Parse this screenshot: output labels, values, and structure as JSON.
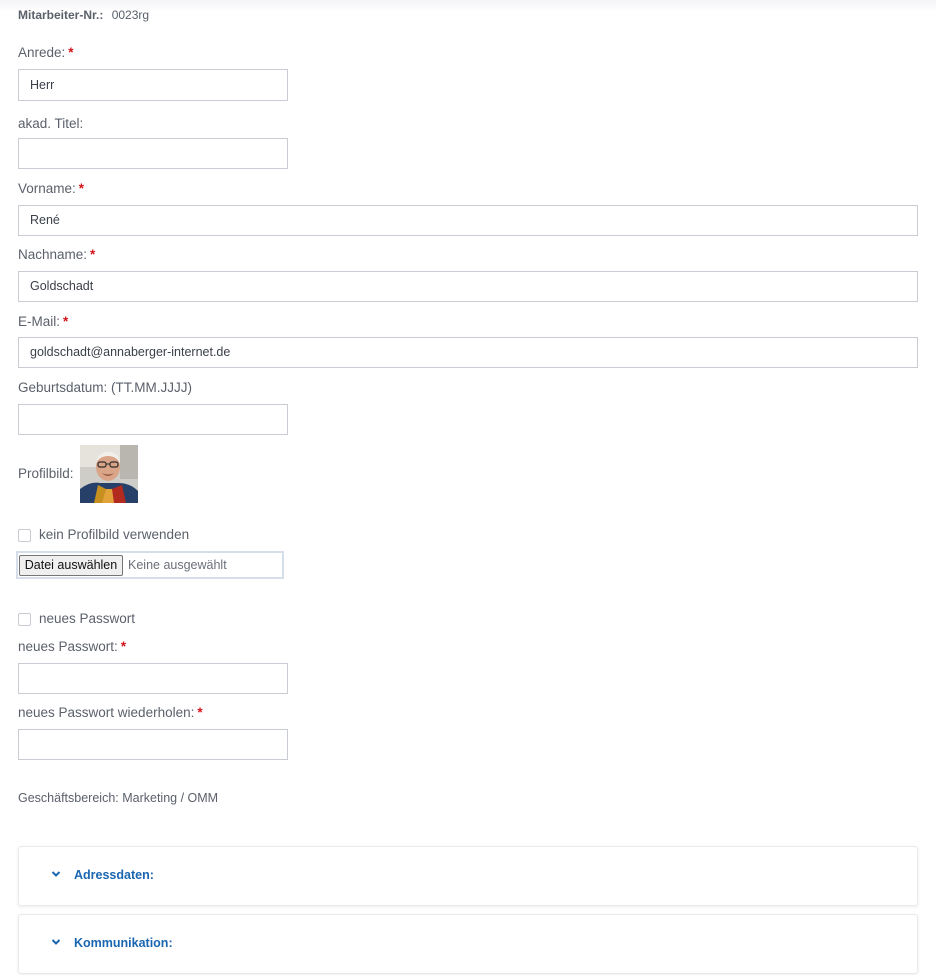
{
  "employee_number": {
    "label": "Mitarbeiter-Nr.:",
    "value": "0023rg"
  },
  "fields": {
    "salutation": {
      "label": "Anrede:",
      "value": "Herr",
      "required": "*"
    },
    "title": {
      "label": "akad. Titel:",
      "value": ""
    },
    "firstname": {
      "label": "Vorname:",
      "value": "René",
      "required": "*"
    },
    "lastname": {
      "label": "Nachname:",
      "value": "Goldschadt",
      "required": "*"
    },
    "email": {
      "label": "E-Mail:",
      "value": "goldschadt@annaberger-internet.de",
      "required": "*"
    },
    "birthdate": {
      "label": "Geburtsdatum: (TT.MM.JJJJ)",
      "value": ""
    }
  },
  "profile_image": {
    "label": "Profilbild:",
    "no_image_label": "kein Profilbild verwenden",
    "file_button": "Datei auswählen",
    "file_status": "Keine ausgewählt"
  },
  "password": {
    "toggle_label": "neues Passwort",
    "new_label": "neues Passwort:",
    "repeat_label": "neues Passwort wiederholen:",
    "required": "*"
  },
  "business_unit": "Geschäftsbereich: Marketing / OMM",
  "panels": {
    "address": "Adressdaten:",
    "communication": "Kommunikation:"
  },
  "colors": {
    "accent": "#1a66b0",
    "required": "#d3141a",
    "border": "#c9ccd2"
  }
}
